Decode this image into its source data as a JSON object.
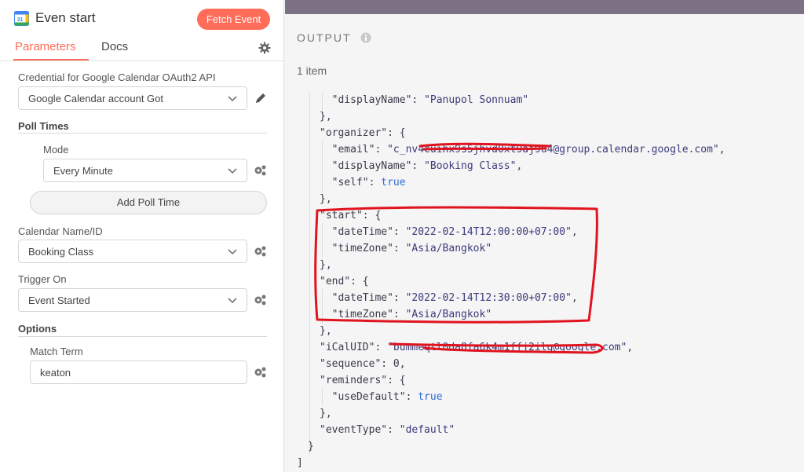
{
  "node": {
    "title": "Even start",
    "fetch_label": "Fetch Event"
  },
  "tabs": [
    {
      "label": "Parameters"
    },
    {
      "label": "Docs"
    }
  ],
  "credential": {
    "label": "Credential for Google Calendar OAuth2 API",
    "value": "Google Calendar account Got"
  },
  "poll": {
    "section": "Poll Times",
    "mode_label": "Mode",
    "mode_value": "Every Minute",
    "add_label": "Add Poll Time"
  },
  "calendar": {
    "label": "Calendar Name/ID",
    "value": "Booking Class"
  },
  "trigger": {
    "label": "Trigger On",
    "value": "Event Started"
  },
  "options": {
    "section": "Options",
    "match_label": "Match Term",
    "match_value": "keaton"
  },
  "output": {
    "title": "OUTPUT",
    "count": "1 item"
  },
  "json_lines": [
    {
      "t": "  \"displayName\": \"Panupol Sonnuam\""
    },
    {
      "t": "},"
    },
    {
      "t": "\"organizer\": {"
    },
    {
      "t": "  \"email\": \"c_nv4cuihx9s5jhvd0xt9aj9u4@group.calendar.google.com\","
    },
    {
      "t": "  \"displayName\": \"Booking Class\","
    },
    {
      "t": "  \"self\": true"
    },
    {
      "t": "},"
    },
    {
      "t": "\"start\": {"
    },
    {
      "t": "  \"dateTime\": \"2022-02-14T12:00:00+07:00\","
    },
    {
      "t": "  \"timeZone\": \"Asia/Bangkok\""
    },
    {
      "t": "},"
    },
    {
      "t": "\"end\": {"
    },
    {
      "t": "  \"dateTime\": \"2022-02-14T12:30:00+07:00\","
    },
    {
      "t": "  \"timeZone\": \"Asia/Bangkok\""
    },
    {
      "t": "},"
    },
    {
      "t": "\"iCalUID\": \"bummeqtl0da8fa6k4m1ffj2ilg@google.com\","
    },
    {
      "t": "\"sequence\": 0,"
    },
    {
      "t": "\"reminders\": {"
    },
    {
      "t": "  \"useDefault\": true"
    },
    {
      "t": "},"
    },
    {
      "t": "\"eventType\": \"default\""
    },
    {
      "t": "}"
    },
    {
      "t": "]"
    }
  ],
  "colors": {
    "accent": "#ff6d5a",
    "annotation": "#e0141e",
    "topbar": "#7c7284"
  }
}
